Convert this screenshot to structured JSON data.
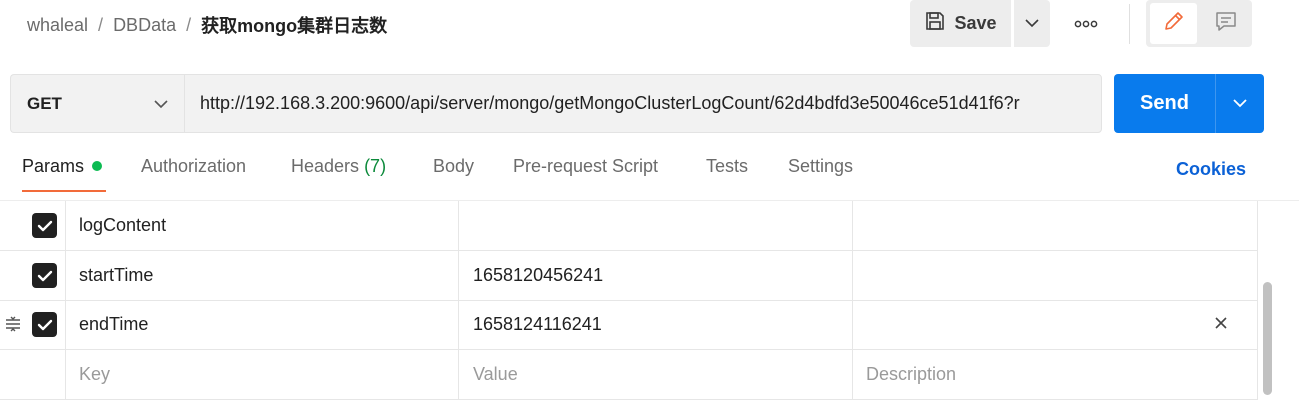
{
  "breadcrumb": {
    "workspace": "whaleal",
    "collection": "DBData",
    "request_name": "获取mongo集群日志数",
    "separator": "/"
  },
  "toolbar": {
    "save_label": "Save",
    "save_icon": "floppy-disk-icon",
    "more_icon": "ellipsis-icon",
    "edit_icon": "pencil-icon",
    "comment_icon": "comment-icon"
  },
  "request": {
    "method": "GET",
    "url": "http://192.168.3.200:9600/api/server/mongo/getMongoClusterLogCount/62d4bdfd3e50046ce51d41f6?r",
    "send_label": "Send"
  },
  "tabs": [
    {
      "label": "Params",
      "active": true,
      "indicator": "green-dot"
    },
    {
      "label": "Authorization"
    },
    {
      "label": "Headers",
      "count": "(7)"
    },
    {
      "label": "Body"
    },
    {
      "label": "Pre-request Script"
    },
    {
      "label": "Tests"
    },
    {
      "label": "Settings"
    }
  ],
  "cookies_label": "Cookies",
  "params": {
    "rows": [
      {
        "key": "logContent",
        "value": "",
        "description": "",
        "checked": true
      },
      {
        "key": "startTime",
        "value": "1658120456241",
        "description": "",
        "checked": true
      },
      {
        "key": "endTime",
        "value": "1658124116241",
        "description": "",
        "checked": true
      }
    ],
    "placeholder_row": {
      "key": "Key",
      "value": "Value",
      "description": "Description"
    }
  },
  "colors": {
    "send_button": "#097bed",
    "active_tab_underline": "#f26b3a",
    "params_dot": "#0cbb52",
    "headers_count": "#0c8a3b",
    "cookies_link": "#0b61d6"
  }
}
